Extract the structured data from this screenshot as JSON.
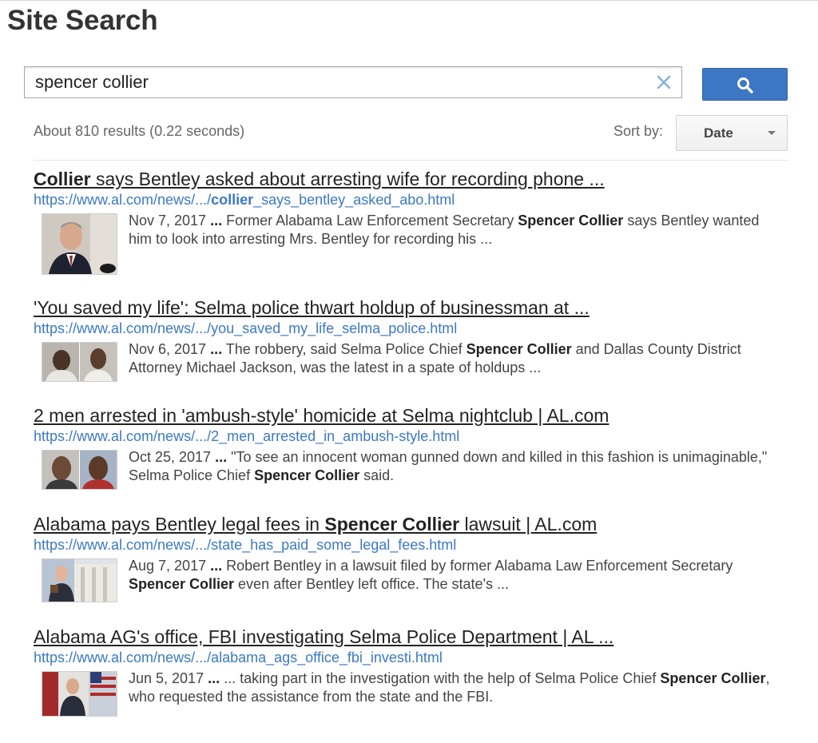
{
  "page": {
    "title": "Site Search"
  },
  "search": {
    "query": "spencer collier",
    "placeholder": "",
    "result_count": "About 810 results (0.22 seconds)",
    "sort_label": "Sort by:",
    "sort_value": "Date",
    "accent_color": "#3d76c2",
    "link_color": "#3b79c4"
  },
  "results": [
    {
      "title_bold": "Collier",
      "title_rest": " says Bentley asked about arresting wife for recording phone ...",
      "url_prefix": "https://www.al.com/news/.../",
      "url_bold": "collier",
      "url_suffix": "_says_bentley_asked_abo.html",
      "date": "Nov 7, 2017",
      "snippet_a": " Former Alabama Law Enforcement Secretary ",
      "snippet_bold": "Spencer Collier",
      "snippet_b": " says Bentley wanted him to look into arresting Mrs. Bentley for recording his ...",
      "thumbnail": "portrait-photo"
    },
    {
      "title": "'You saved my life': Selma police thwart holdup of businessman at ...",
      "url": "https://www.al.com/news/.../you_saved_my_life_selma_police.html",
      "date": "Nov 6, 2017",
      "snippet_a": " The robbery, said Selma Police Chief ",
      "snippet_bold": "Spencer Collier",
      "snippet_b": " and Dallas County District Attorney Michael Jackson, was the latest in a spate of holdups ...",
      "thumbnail": "mugshots-photo"
    },
    {
      "title": "2 men arrested in 'ambush-style' homicide at Selma nightclub | AL.com",
      "url": "https://www.al.com/news/.../2_men_arrested_in_ambush-style.html",
      "date": "Oct 25, 2017",
      "snippet_a": " \"To see an innocent woman gunned down and killed in this fashion is unimaginable,\" Selma Police Chief ",
      "snippet_bold": "Spencer Collier",
      "snippet_b": " said.",
      "thumbnail": "mugshots-photo"
    },
    {
      "title_a": "Alabama pays Bentley legal fees in ",
      "title_bold": "Spencer Collier",
      "title_b": " lawsuit | AL.com",
      "url": "https://www.al.com/news/.../state_has_paid_some_legal_fees.html",
      "date": "Aug 7, 2017",
      "snippet_a": " Robert Bentley in a lawsuit filed by former Alabama Law Enforcement Secretary ",
      "snippet_bold": "Spencer Collier",
      "snippet_b": " even after Bentley left office. The state's ...",
      "thumbnail": "building-photo"
    },
    {
      "title": "Alabama AG's office, FBI investigating Selma Police Department | AL ...",
      "url": "https://www.al.com/news/.../alabama_ags_office_fbi_investi.html",
      "date": "Jun 5, 2017",
      "snippet_a": " ... taking part in the investigation with the help of Selma Police Chief ",
      "snippet_bold": "Spencer Collier",
      "snippet_b": ", who requested the assistance from the state and the FBI.",
      "thumbnail": "press-conference-photo"
    }
  ],
  "ellipsis": "..."
}
